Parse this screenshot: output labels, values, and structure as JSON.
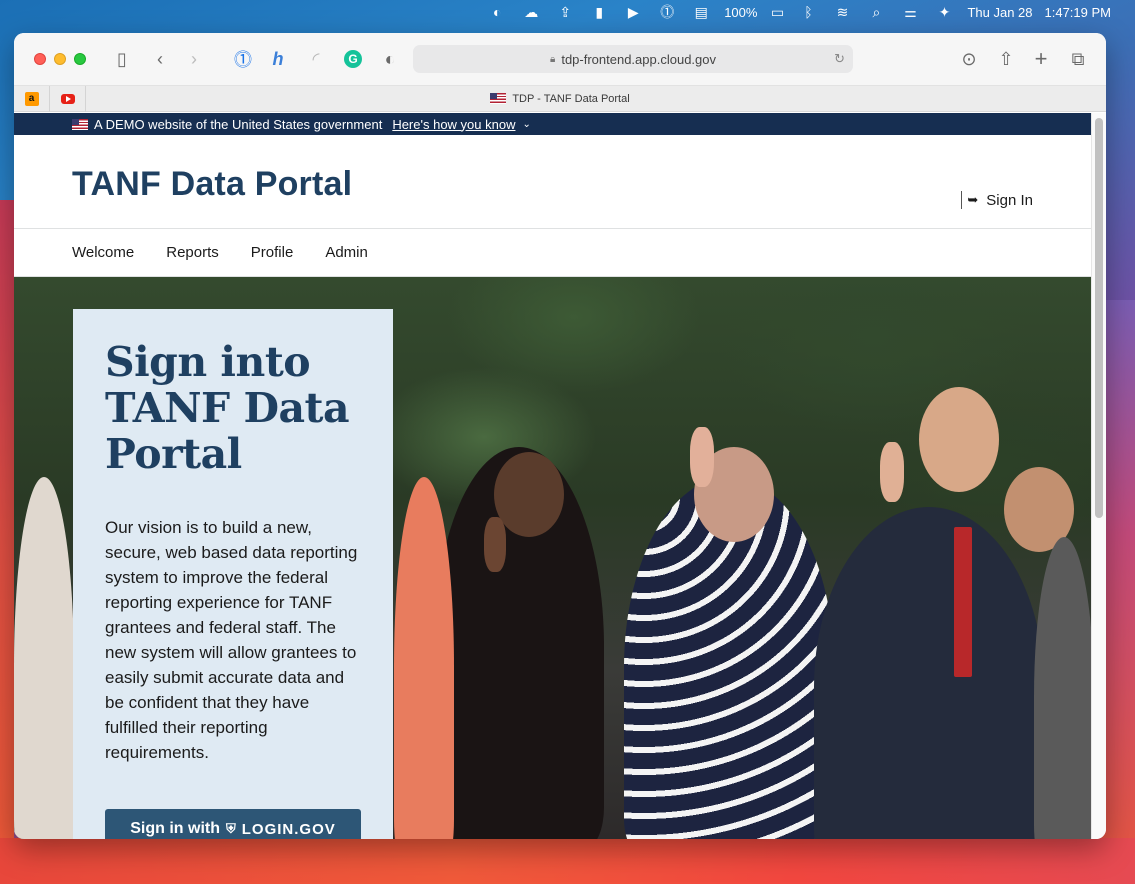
{
  "menubar": {
    "battery": "100%",
    "date": "Thu Jan 28",
    "time": "1:47:19 PM"
  },
  "browser": {
    "url": "tdp-frontend.app.cloud.gov",
    "tab_title": "TDP - TANF Data Portal",
    "favorites": [
      {
        "name": "amazon-favicon",
        "glyph": "a"
      },
      {
        "name": "youtube-favicon",
        "glyph": ""
      }
    ]
  },
  "page": {
    "gov_banner": {
      "text": "A DEMO website of the United States government",
      "link": "Here's how you know"
    },
    "header": {
      "title": "TANF Data Portal",
      "sign_in": "Sign In"
    },
    "nav": {
      "items": [
        "Welcome",
        "Reports",
        "Profile",
        "Admin"
      ]
    },
    "hero": {
      "heading": "Sign into TANF Data Portal",
      "body": "Our vision is to build a new, secure, web based data reporting system to improve the federal reporting experience for TANF grantees and federal staff. The new system will allow grantees to easily submit accurate data and be confident that they have fulfilled their reporting requirements.",
      "button_prefix": "Sign in with",
      "button_brand": "LOGIN.GOV"
    }
  },
  "colors": {
    "banner_bg": "#162e51",
    "title": "#1f4061",
    "card_bg": "#dfeaf3",
    "button_bg": "#2d5676"
  }
}
